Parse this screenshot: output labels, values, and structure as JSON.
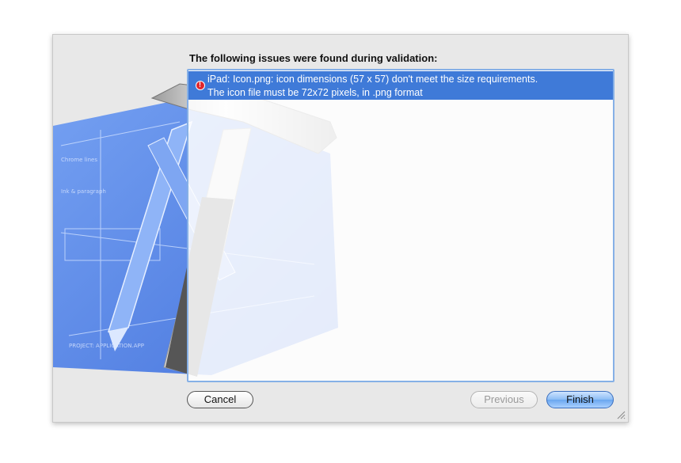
{
  "dialog": {
    "heading": "The following issues were found during validation:",
    "issues": [
      {
        "line1": "iPad: Icon.png: icon dimensions (57 x 57) don't meet the size requirements.",
        "line2": "The icon file must be 72x72 pixels, in .png format",
        "icon": "error-icon",
        "selected": true
      }
    ],
    "buttons": {
      "cancel": "Cancel",
      "previous": "Previous",
      "finish": "Finish"
    },
    "background_art": "xcode-hammer-blueprint",
    "colors": {
      "selection": "#3f7ad8",
      "list_border": "#86b0e6",
      "error": "#e0242a",
      "blueprint": "#4d7fe6"
    }
  }
}
